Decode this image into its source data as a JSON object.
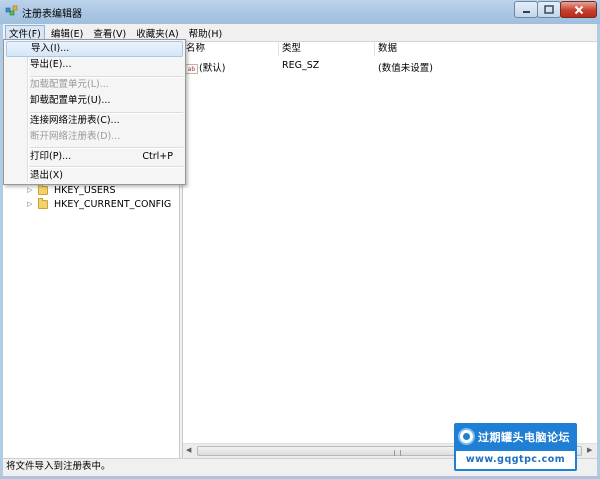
{
  "window": {
    "title": "注册表编辑器"
  },
  "menubar": {
    "items": [
      "文件(F)",
      "编辑(E)",
      "查看(V)",
      "收藏夹(A)",
      "帮助(H)"
    ]
  },
  "file_menu": {
    "items": [
      {
        "label": "导入(I)...",
        "state": "hover"
      },
      {
        "label": "导出(E)...",
        "state": "normal"
      },
      {
        "label": "加载配置单元(L)...",
        "state": "disabled"
      },
      {
        "label": "卸载配置单元(U)...",
        "state": "normal"
      },
      {
        "label": "连接网络注册表(C)...",
        "state": "normal"
      },
      {
        "label": "断开网络注册表(D)...",
        "state": "disabled"
      },
      {
        "label": "打印(P)...",
        "shortcut": "Ctrl+P",
        "state": "normal"
      },
      {
        "label": "退出(X)",
        "state": "normal"
      }
    ]
  },
  "tree": {
    "items": [
      "HKEY_USERS",
      "HKEY_CURRENT_CONFIG"
    ]
  },
  "list": {
    "columns": [
      "名称",
      "类型",
      "数据"
    ],
    "rows": [
      {
        "icon": "ab",
        "name": "(默认)",
        "type": "REG_SZ",
        "data": "(数值未设置)"
      }
    ]
  },
  "statusbar": {
    "text": "将文件导入到注册表中。"
  },
  "watermark": {
    "name": "过期罐头电脑论坛",
    "url": "www.gqgtpc.com"
  },
  "colors": {
    "titlebar": "#a9c5e2",
    "menu_hover": "#d6e6f7",
    "watermark": "#1f7fd4",
    "close_button": "#c7402f"
  }
}
